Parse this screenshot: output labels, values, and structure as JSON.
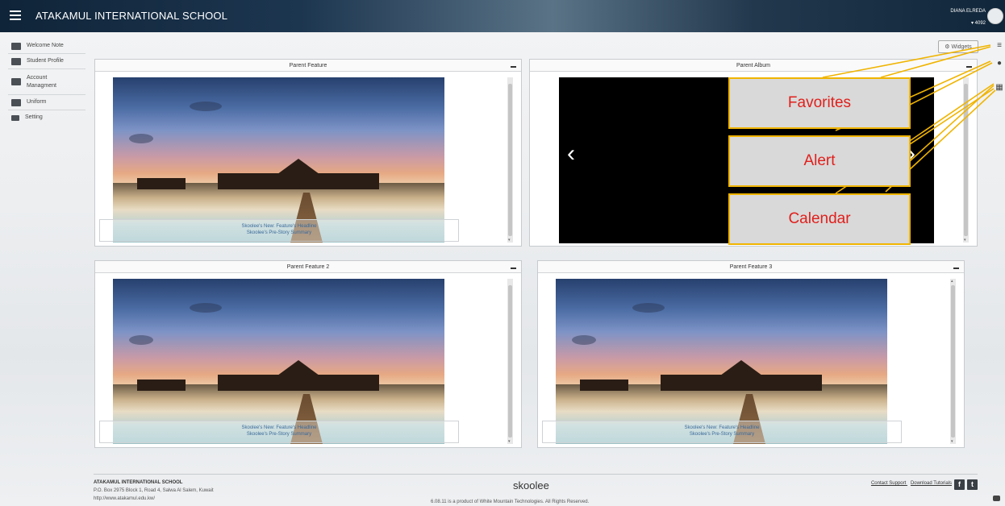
{
  "header": {
    "school_name": "ATAKAMUL INTERNATIONAL SCHOOL",
    "user_name": "DIANA ELREDA",
    "user_id": "4092"
  },
  "sidebar": {
    "items": [
      {
        "label": "Welcome Note",
        "icon": "note-icon"
      },
      {
        "label": "Student Profile",
        "icon": "student-icon"
      },
      {
        "label": "Account\nManagment",
        "icon": "account-icon"
      },
      {
        "label": "Uniform",
        "icon": "uniform-icon"
      },
      {
        "label": "Setting",
        "icon": "setting-icon"
      }
    ]
  },
  "toolbar": {
    "widgets_label": "Widgets"
  },
  "panels": {
    "feature1": {
      "title": "Parent Feature",
      "headline": "Skoolee's New: Feature's Headline",
      "summary": "Skoolee's Pre-Story Summary"
    },
    "album": {
      "title": "Parent Album",
      "prev": "‹",
      "next": "›"
    },
    "feature2": {
      "title": "Parent Feature 2",
      "headline": "Skoolee's New: Feature's Headline",
      "summary": "Skoolee's Pre-Story Summary"
    },
    "feature3": {
      "title": "Parent Feature 3",
      "headline": "Skoolee's New: Feature's Headline",
      "summary": "Skoolee's Pre-Story Summary"
    }
  },
  "annotations": {
    "favorites": "Favorites",
    "alert": "Alert",
    "calendar": "Calendar",
    "color": "#f0b400",
    "text_color": "#e0201c"
  },
  "footer": {
    "school_name": "ATAKAMUL INTERNATIONAL SCHOOL",
    "address": "P.O. Box 2975 Block 1, Road 4, Salwa Al Salem, Kuwait",
    "url": "http://www.atakamul.edu.kw/",
    "logo": "skoolee",
    "copyright": "6.08.11  is a product of White Mountain Technologies. All Rights Reserved.",
    "contact_support": "Contact Support",
    "download_tutorials": "Download Tutorials",
    "facebook": "f",
    "twitter": "t"
  }
}
